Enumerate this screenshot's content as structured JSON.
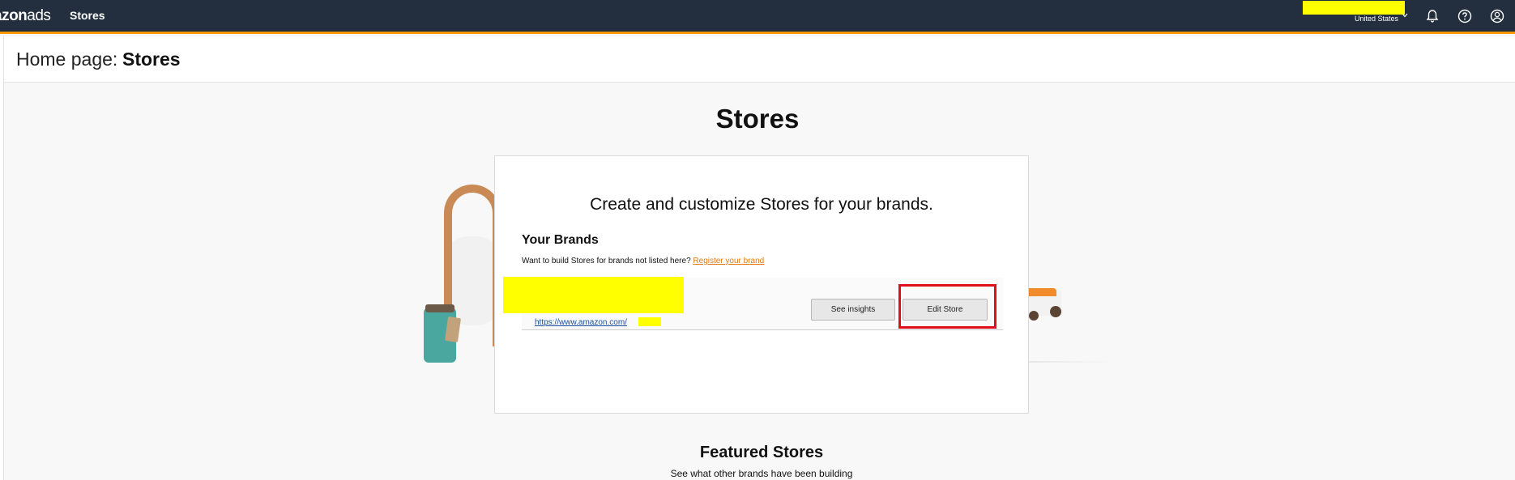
{
  "nav": {
    "logo_prefix": "azon",
    "logo_suffix": "ads",
    "current_section": "Stores",
    "account_country": "United States",
    "icons": [
      "chevron-down-icon",
      "bell-icon",
      "help-icon",
      "user-icon"
    ]
  },
  "header": {
    "prefix": "Home page:",
    "title": "Stores"
  },
  "main": {
    "title": "Stores",
    "card": {
      "headline": "Create and customize Stores for your brands.",
      "brands_title": "Your Brands",
      "brands_note": "Want to build Stores for brands not listed here?",
      "register_link": "Register your brand",
      "brand": {
        "store_url": "https://www.amazon.com/",
        "insights_button": "See insights",
        "edit_button": "Edit Store"
      }
    },
    "featured": {
      "title": "Featured Stores",
      "subtitle": "See what other brands have been building"
    }
  },
  "colors": {
    "nav_bg": "#232f3e",
    "nav_accent": "#ff9900",
    "link": "#e47911",
    "redaction": "#ffff00",
    "highlight": "#e0101a"
  }
}
